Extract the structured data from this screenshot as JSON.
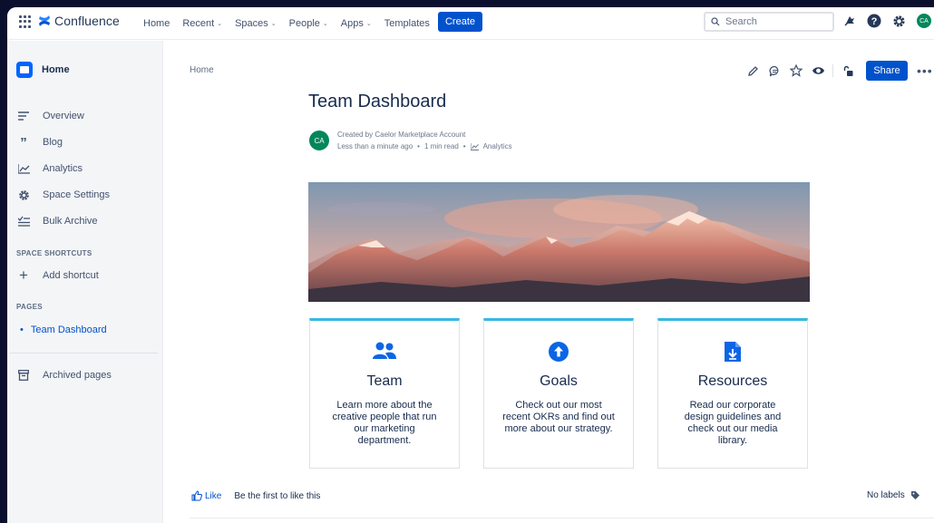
{
  "app": {
    "name": "Confluence"
  },
  "topnav": {
    "items": [
      {
        "label": "Home",
        "dropdown": false
      },
      {
        "label": "Recent",
        "dropdown": true
      },
      {
        "label": "Spaces",
        "dropdown": true
      },
      {
        "label": "People",
        "dropdown": true
      },
      {
        "label": "Apps",
        "dropdown": true
      },
      {
        "label": "Templates",
        "dropdown": false
      }
    ],
    "create_label": "Create",
    "search_placeholder": "Search",
    "icons": [
      "notifications-icon",
      "help-icon",
      "settings-icon",
      "user-avatar"
    ]
  },
  "sidebar": {
    "home_label": "Home",
    "items": [
      {
        "label": "Overview",
        "icon": "overview-icon"
      },
      {
        "label": "Blog",
        "icon": "quote-icon"
      },
      {
        "label": "Analytics",
        "icon": "analytics-icon"
      },
      {
        "label": "Space Settings",
        "icon": "gear-icon"
      },
      {
        "label": "Bulk Archive",
        "icon": "checklist-icon"
      }
    ],
    "shortcuts_heading": "SPACE SHORTCUTS",
    "add_shortcut_label": "Add shortcut",
    "pages_heading": "PAGES",
    "pages": [
      {
        "label": "Team Dashboard"
      }
    ],
    "archived_label": "Archived pages"
  },
  "page": {
    "breadcrumb": "Home",
    "share_label": "Share",
    "title": "Team Dashboard",
    "author_initials": "CA",
    "created_by": "Created by Caelor Marketplace Account",
    "time": "Less than a minute ago",
    "read_time": "1 min read",
    "analytics_label": "Analytics",
    "cards": [
      {
        "title": "Team",
        "description": "Learn more about the creative people that run our marketing department.",
        "icon": "people-icon"
      },
      {
        "title": "Goals",
        "description": "Check out our most recent OKRs and find out more about our strategy.",
        "icon": "arrow-up-circle-icon"
      },
      {
        "title": "Resources",
        "description": "Read our corporate design guidelines and check out our media library.",
        "icon": "download-document-icon"
      }
    ],
    "like_label": "Like",
    "like_text": "Be the first to like this",
    "labels_text": "No labels"
  },
  "colors": {
    "primary": "#0052cc",
    "card_accent": "#36b9e1",
    "avatar": "#00875a",
    "sidebar_bg": "#f4f5f7"
  }
}
